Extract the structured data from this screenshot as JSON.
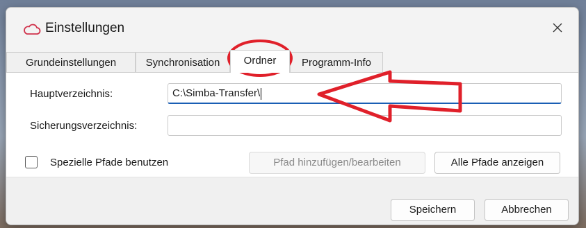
{
  "window": {
    "title": "Einstellungen",
    "icon": "cloud-icon"
  },
  "tabs": [
    {
      "label": "Grundeinstellungen",
      "active": false
    },
    {
      "label": "Synchronisation",
      "active": false
    },
    {
      "label": "Ordner",
      "active": true
    },
    {
      "label": "Programm-Info",
      "active": false
    }
  ],
  "fields": {
    "main_dir_label": "Hauptverzeichnis:",
    "main_dir_value": "C:\\Simba-Transfer\\",
    "backup_dir_label": "Sicherungsverzeichnis:",
    "backup_dir_value": ""
  },
  "special_paths": {
    "checkbox_label": "Spezielle Pfade benutzen",
    "checked": false,
    "edit_button": "Pfad hinzufügen/bearbeiten",
    "show_button": "Alle Pfade anzeigen"
  },
  "footer": {
    "save": "Speichern",
    "cancel": "Abbrechen"
  },
  "annotation_color": "#e0202a"
}
